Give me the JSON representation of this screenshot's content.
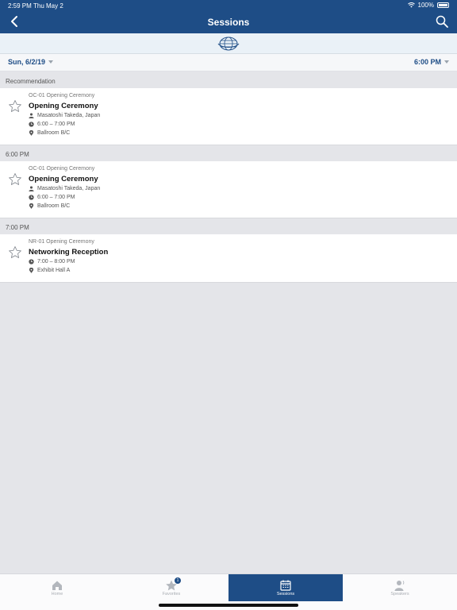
{
  "status": {
    "time": "2:59 PM",
    "date": "Thu May 2",
    "battery": "100%"
  },
  "header": {
    "title": "Sessions"
  },
  "filters": {
    "date": "Sun, 6/2/19",
    "time": "6:00 PM"
  },
  "sections": [
    {
      "title": "Recommendation",
      "sessions": [
        {
          "code": "OC-01 Opening Ceremony",
          "name": "Opening Ceremony",
          "speaker": "Masatoshi Takeda, Japan",
          "time": "6:00 – 7:00 PM",
          "location": "Ballroom B/C"
        }
      ]
    },
    {
      "title": "6:00 PM",
      "sessions": [
        {
          "code": "OC-01 Opening Ceremony",
          "name": "Opening Ceremony",
          "speaker": "Masatoshi Takeda, Japan",
          "time": "6:00 – 7:00 PM",
          "location": "Ballroom B/C"
        }
      ]
    },
    {
      "title": "7:00 PM",
      "sessions": [
        {
          "code": "NR-01 Opening Ceremony",
          "name": "Networking Reception",
          "time": "7:00 – 8:00 PM",
          "location": "Exhibit Hall A"
        }
      ]
    }
  ],
  "tabs": [
    {
      "label": "Home",
      "icon": "home-icon"
    },
    {
      "label": "Favorites",
      "icon": "star-icon",
      "badge": "1"
    },
    {
      "label": "Sessions",
      "icon": "calendar-icon",
      "active": true
    },
    {
      "label": "Speakers",
      "icon": "speaker-icon"
    }
  ],
  "colors": {
    "primary": "#1e4d86",
    "background": "#e4e5e9"
  }
}
